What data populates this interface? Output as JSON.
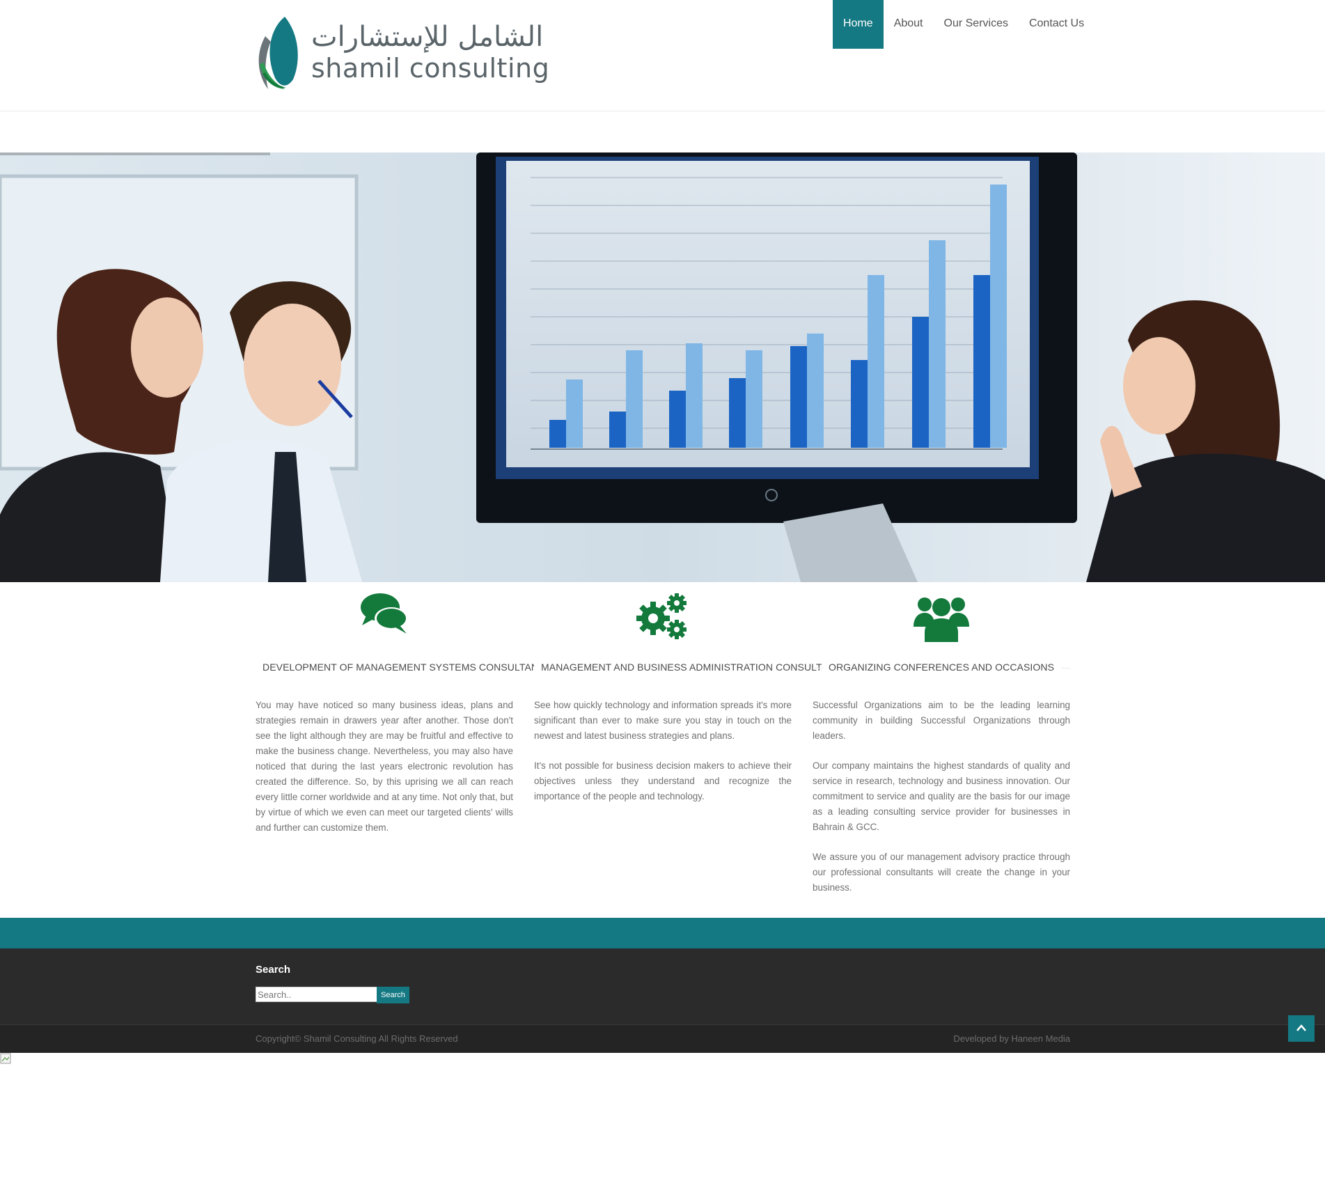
{
  "brand": {
    "arabic": "الشامل للإستشارات",
    "english": "shamil consulting"
  },
  "nav": {
    "items": [
      {
        "label": "Home",
        "active": true
      },
      {
        "label": "About",
        "active": false
      },
      {
        "label": "Our Services",
        "active": false
      },
      {
        "label": "Contact Us",
        "active": false
      }
    ]
  },
  "features": [
    {
      "icon": "comments-icon",
      "title": "DEVELOPMENT OF MANAGEMENT SYSTEMS CONSULTANCY",
      "paragraphs": [
        "You may have noticed so many business ideas, plans and strategies remain in drawers year after another. Those don't see the light although they are may be fruitful and effective to make the business change. Nevertheless, you may also have noticed that during the last years electronic revolution has created the difference. So, by this uprising we all can reach every little corner worldwide and at any time. Not only that, but by virtue of which we even can meet our targeted clients' wills and further can customize them."
      ]
    },
    {
      "icon": "gears-icon",
      "title": "MANAGEMENT AND BUSINESS ADMINISTRATION CONSULTANTS",
      "paragraphs": [
        "See how quickly technology and information spreads it's more significant than ever to make sure you stay in touch on the newest and latest business strategies and plans.",
        "It's not possible for business decision makers to achieve their objectives unless they understand and recognize the importance of the people and technology."
      ]
    },
    {
      "icon": "users-icon",
      "title": "ORGANIZING CONFERENCES AND OCCASIONS",
      "paragraphs": [
        "Successful Organizations aim to be the leading learning community in building Successful Organizations through leaders.",
        "Our company maintains the highest standards of quality and service in research, technology and business innovation. Our commitment to service and quality are the basis for our image as a leading consulting service provider for businesses in Bahrain & GCC.",
        "We assure you of our management advisory practice through our professional consultants will create the change in your business."
      ]
    }
  ],
  "footer": {
    "search_title": "Search",
    "search_placeholder": "Search..",
    "search_button": "Search",
    "copyright": "Copyright© Shamil Consulting All Rights Reserved",
    "developed_by": "Developed by Haneen Media"
  },
  "colors": {
    "accent": "#147983",
    "icon_green": "#137a3c",
    "footer_bg": "#2b2b2b"
  }
}
